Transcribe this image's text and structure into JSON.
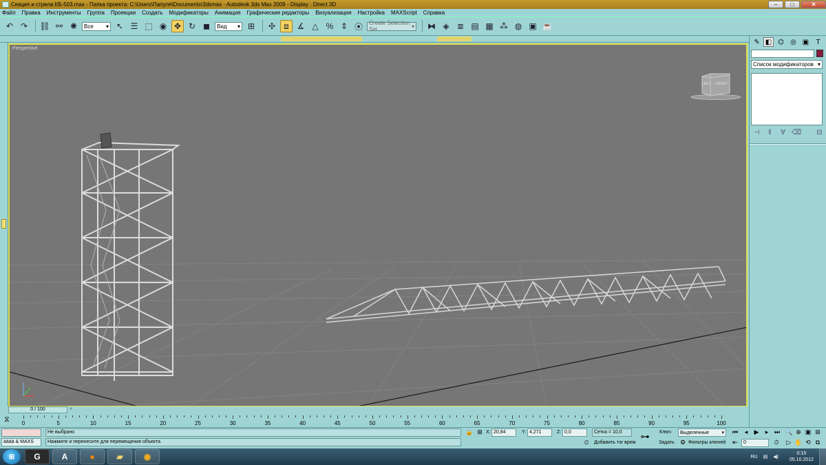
{
  "window": {
    "title": "Секция и стрела КБ-503.max    - Папка проекта: C:\\Users\\Папуля\\Documents\\3dsmax    - Autodesk 3ds Max  2009     - Display : Direct 3D"
  },
  "menu": [
    "Файл",
    "Правка",
    "Инструменты",
    "Группа",
    "Проекции",
    "Создать",
    "Модификаторы",
    "Анимация",
    "Графические редакторы",
    "Визуализация",
    "Настройка",
    "MAXScript",
    "Справка"
  ],
  "toolbar": {
    "selection_filter": "Все",
    "ref_coord": "Вид",
    "named_selection_placeholder": "Create Selection Set"
  },
  "viewport": {
    "label": "Perspective",
    "viewcube_left": "LEFT",
    "viewcube_front": "FRONT"
  },
  "command_panel": {
    "modifier_list": "Список модификаторов"
  },
  "timeslider": {
    "position": "0 / 100"
  },
  "trackbar": {
    "labels": [
      "0",
      "5",
      "10",
      "15",
      "20",
      "25",
      "30",
      "35",
      "40",
      "45",
      "50",
      "55",
      "60",
      "65",
      "70",
      "75",
      "80",
      "85",
      "90",
      "95",
      "100"
    ]
  },
  "status": {
    "maxscript": "ääää & MAXS",
    "selection": "Не выбрано",
    "prompt": "Нажмите и перенесите для перемещения объекта",
    "x_label": "X:",
    "x_value": "20,84",
    "y_label": "Y:",
    "y_value": "4,271",
    "z_label": "Z:",
    "z_value": "0,0",
    "grid": "Сетка = 10,0",
    "add_time_tag": "Добавить тэг врем",
    "key_label": "Ключ",
    "key_mode": "Выделенные",
    "set_label": "Задать",
    "key_filters": "Фильтры ключей",
    "frame": "0"
  },
  "taskbar": {
    "lang": "RU",
    "time": "0:15",
    "date": "05.10.2012"
  }
}
